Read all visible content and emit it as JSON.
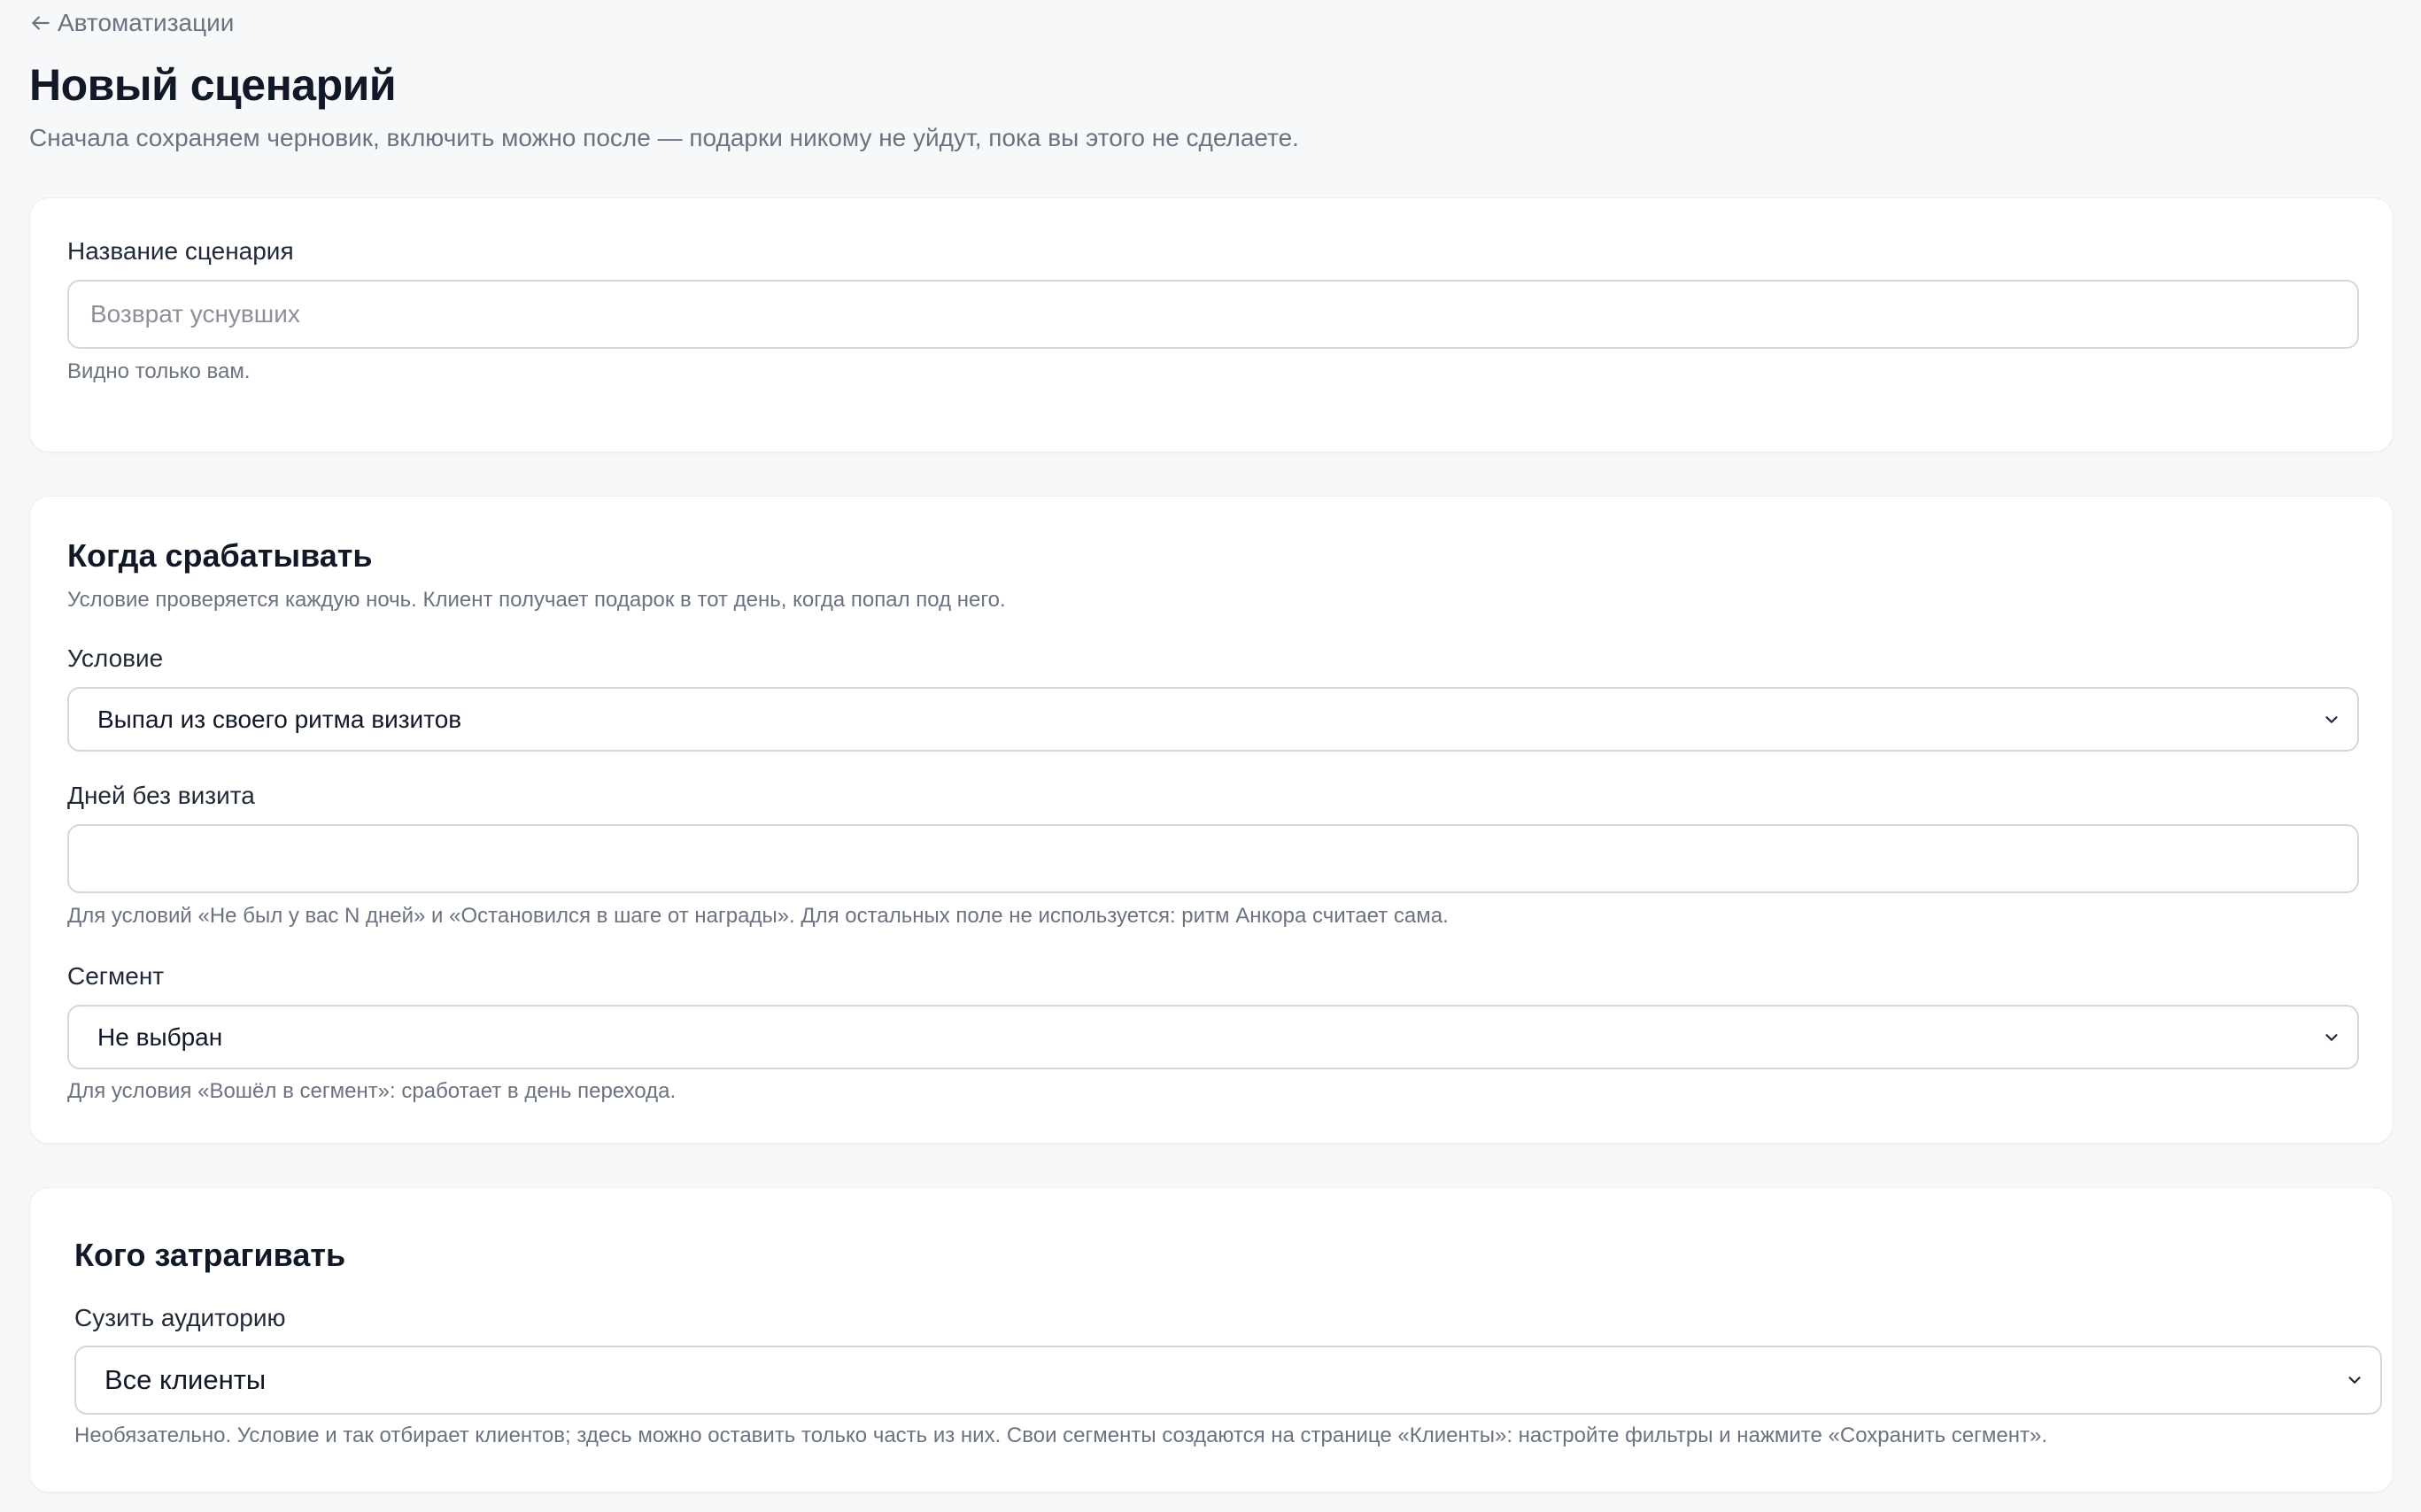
{
  "nav": {
    "back_label": "Автоматизации"
  },
  "header": {
    "title": "Новый сценарий",
    "subtitle": "Сначала сохраняем черновик, включить можно после — подарки никому не уйдут, пока вы этого не сделаете."
  },
  "name_card": {
    "label": "Название сценария",
    "placeholder": "Возврат уснувших",
    "value": "",
    "hint": "Видно только вам."
  },
  "trigger_card": {
    "title": "Когда срабатывать",
    "description": "Условие проверяется каждую ночь. Клиент получает подарок в тот день, когда попал под него.",
    "condition": {
      "label": "Условие",
      "selected": "Выпал из своего ритма визитов"
    },
    "days": {
      "label": "Дней без визита",
      "value": "",
      "hint": "Для условий «Не был у вас N дней» и «Остановился в шаге от награды». Для остальных поле не используется: ритм Анкора считает сама."
    },
    "segment": {
      "label": "Сегмент",
      "selected": "Не выбран",
      "hint": "Для условия «Вошёл в сегмент»: сработает в день перехода."
    }
  },
  "audience_card": {
    "title": "Кого затрагивать",
    "narrow": {
      "label": "Сузить аудиторию",
      "selected": "Все клиенты",
      "hint": "Необязательно. Условие и так отбирает клиентов; здесь можно оставить только часть из них. Свои сегменты создаются на странице «Клиенты»: настройте фильтры и нажмите «Сохранить сегмент»."
    }
  },
  "icons": {
    "back": "arrow-left-icon",
    "select": "chevron-down-icon"
  },
  "colors": {
    "background": "#f7f8fa",
    "card": "#ffffff",
    "border": "#d4d7dd",
    "muted_text": "#6b7280",
    "heading": "#111827"
  }
}
